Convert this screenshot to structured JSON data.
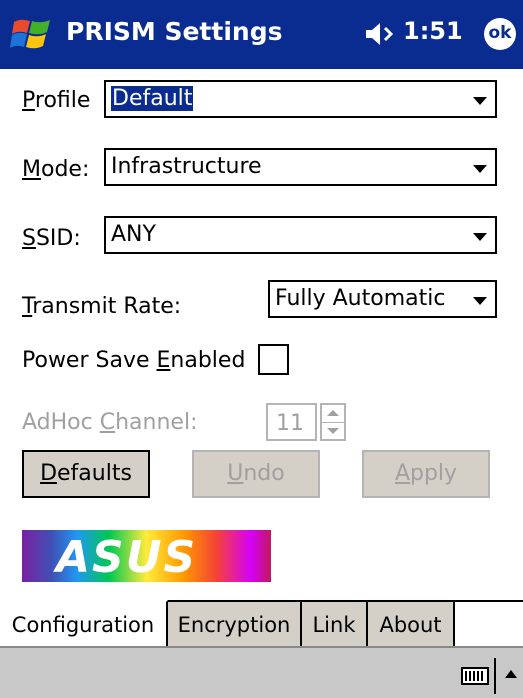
{
  "titlebar": {
    "title": "PRISM Settings",
    "time": "1:51",
    "ok_label": "ok",
    "start_icon": "windows-flag-icon",
    "volume_icon": "speaker-icon"
  },
  "form": {
    "profile": {
      "label_u": "P",
      "label_rest": "rofile",
      "value": "Default"
    },
    "mode": {
      "label_u": "M",
      "label_rest": "ode:",
      "value": "Infrastructure"
    },
    "ssid": {
      "label_u": "S",
      "label_rest": "SID:",
      "value": "ANY"
    },
    "transmit_rate": {
      "label_u": "T",
      "label_rest": "ransmit Rate:",
      "value": "Fully Automatic"
    },
    "power_save": {
      "label_pre": "Power Save ",
      "label_u": "E",
      "label_rest": "nabled",
      "checked": false
    },
    "adhoc_channel": {
      "label_pre": "AdHoc ",
      "label_u": "C",
      "label_rest": "hannel:",
      "value": "11"
    }
  },
  "buttons": {
    "defaults": {
      "u": "D",
      "rest": "efaults"
    },
    "undo": {
      "u": "U",
      "rest": "ndo"
    },
    "apply": {
      "u": "A",
      "rest": "pply"
    }
  },
  "logo": {
    "text": "ASUS"
  },
  "tabs": [
    "Configuration",
    "Encryption",
    "Link",
    "About"
  ],
  "menubar": {
    "keyboard_icon": "keyboard-icon",
    "sip_arrow": "sip-up-arrow-icon"
  },
  "colors": {
    "titlebar": "#0a2b8f",
    "selection": "#0a2b8f",
    "button_face": "#d4d0c8"
  }
}
